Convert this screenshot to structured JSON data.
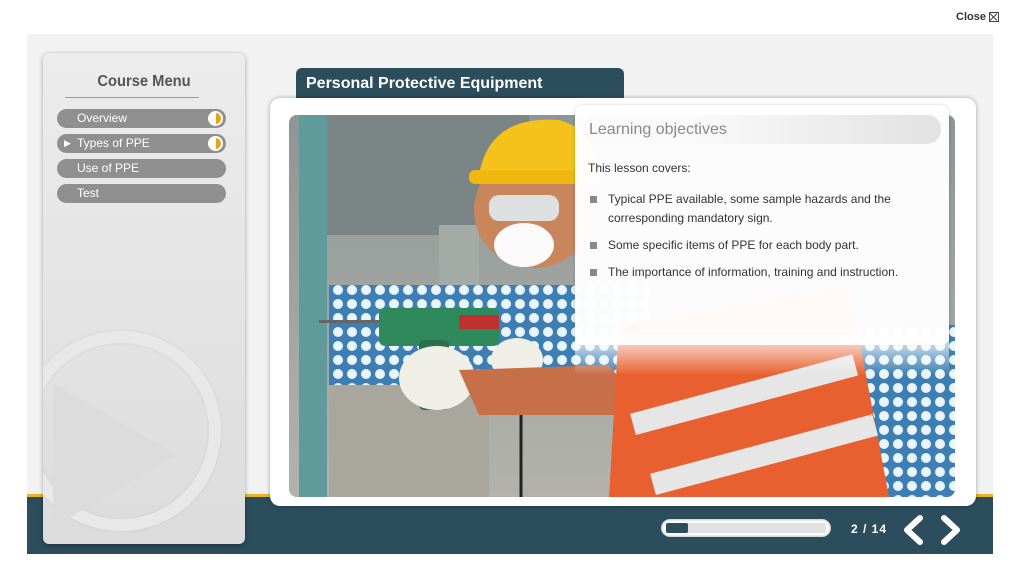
{
  "window": {
    "close_label": "Close"
  },
  "menu": {
    "title": "Course Menu",
    "items": [
      {
        "label": "Overview",
        "arrow": "",
        "status": "half-complete"
      },
      {
        "label": "Types of PPE",
        "arrow": "▶",
        "status": "half-complete"
      },
      {
        "label": "Use of PPE",
        "arrow": "",
        "status": ""
      },
      {
        "label": "Test",
        "arrow": "",
        "status": ""
      }
    ]
  },
  "page": {
    "title": "Personal Protective Equipment"
  },
  "objectives": {
    "heading": "Learning objectives",
    "intro": "This lesson covers:",
    "items": [
      "Typical PPE available, some sample hazards and the corresponding mandatory sign.",
      "Some specific items of PPE for each body part.",
      "The importance of information, training and instruction."
    ]
  },
  "photo": {
    "subject": "worker-drilling-with-ppe-image"
  },
  "footer": {
    "progress": 0.14,
    "page_current": "2",
    "page_total": "14",
    "page_label": "2 / 14"
  },
  "colors": {
    "accent_dark": "#2b4d5c",
    "accent_gold": "#e9b323",
    "menu_item": "#8f8f8f"
  }
}
